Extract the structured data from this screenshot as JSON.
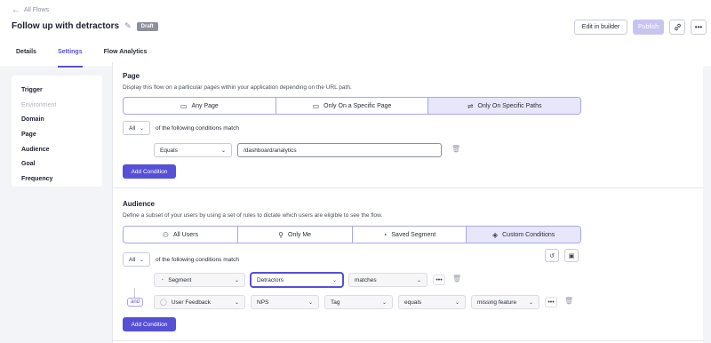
{
  "header": {
    "back_label": "All Flows",
    "title": "Follow up with detractors",
    "status_badge": "Draft",
    "edit_label": "Edit in builder",
    "publish_label": "Publish",
    "link_icon": "link-icon",
    "more_icon": "more-icon"
  },
  "tabs": [
    {
      "label": "Details"
    },
    {
      "label": "Settings",
      "active": true
    },
    {
      "label": "Flow Analytics"
    }
  ],
  "nav": {
    "items": [
      {
        "label": "Trigger"
      },
      {
        "label": "Environment",
        "muted": true
      },
      {
        "label": "Domain"
      },
      {
        "label": "Page"
      },
      {
        "label": "Audience"
      },
      {
        "label": "Goal"
      },
      {
        "label": "Frequency"
      }
    ]
  },
  "page": {
    "title": "Page",
    "description": "Display this flow on a particular pages within your application depending on the URL path.",
    "options": [
      "Any Page",
      "Only On a Specific Page",
      "Only On Specific Paths"
    ],
    "selected": "Only On Specific Paths",
    "match_value": "All",
    "match_suffix": "of the following conditions match",
    "operator": "Equals",
    "path_value": "/dashboard/analytics",
    "add_condition": "Add Condition"
  },
  "audience": {
    "title": "Audience",
    "description": "Define a subset of your users by using a set of rules to dictate which users are eligible to see the flow.",
    "options": [
      "All Users",
      "Only Me",
      "Saved Segment",
      "Custom Conditions"
    ],
    "selected": "Custom Conditions",
    "match_value": "All",
    "match_suffix": "of the following conditions match",
    "row1": {
      "type": "Segment",
      "value": "Detractors",
      "operator": "matches"
    },
    "connector": "and",
    "row2": {
      "type": "User Feedback",
      "survey": "NPS",
      "field": "Tag",
      "operator": "equals",
      "value": "missing feature"
    },
    "add_condition": "Add Condition"
  },
  "colors": {
    "accent": "#5650d6",
    "accent_light": "#e7e6fa",
    "badge": "#8d909c",
    "publish_disabled": "#c7c5ef"
  }
}
